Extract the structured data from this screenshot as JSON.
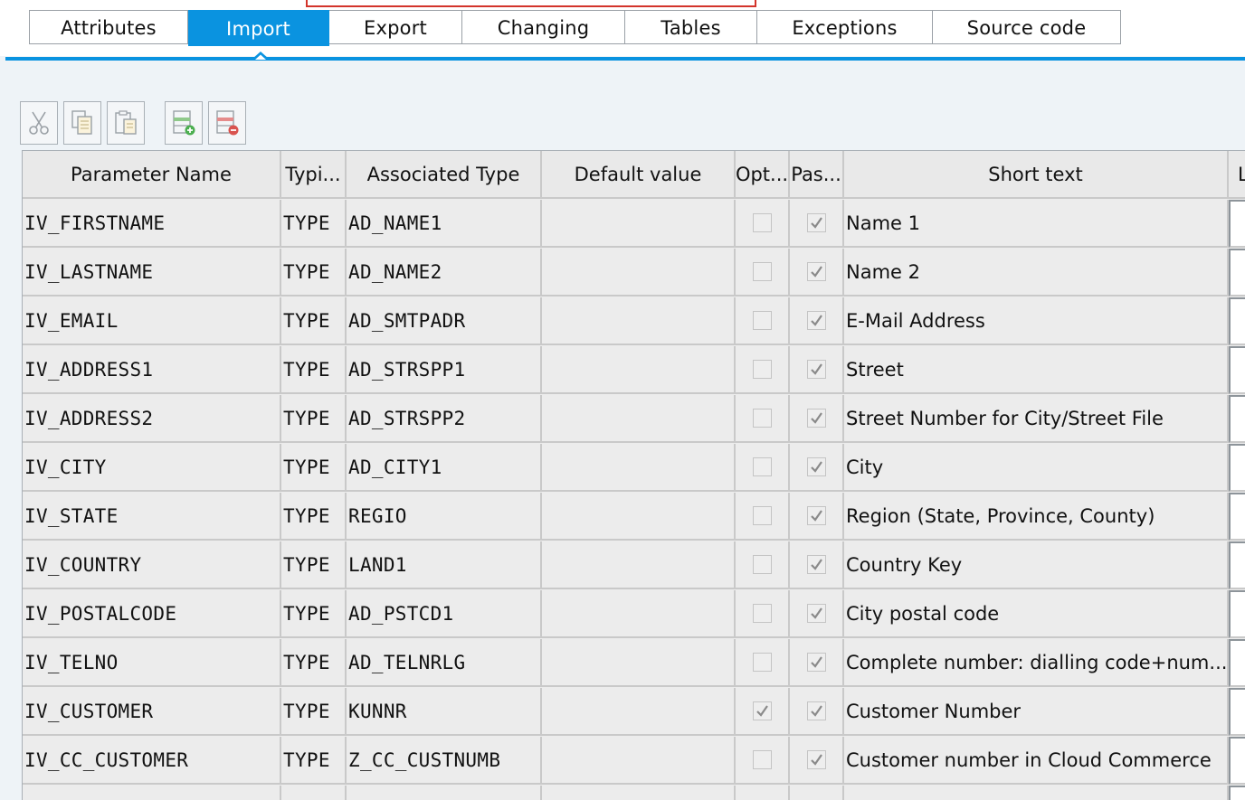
{
  "tabs": [
    {
      "label": "Attributes",
      "active": false
    },
    {
      "label": "Import",
      "active": true
    },
    {
      "label": "Export",
      "active": false
    },
    {
      "label": "Changing",
      "active": false
    },
    {
      "label": "Tables",
      "active": false
    },
    {
      "label": "Exceptions",
      "active": false
    },
    {
      "label": "Source code",
      "active": false
    }
  ],
  "toolbar": {
    "buttons": [
      {
        "icon": "cut-icon"
      },
      {
        "icon": "copy-icon"
      },
      {
        "icon": "paste-icon"
      },
      {
        "icon": "insert-row-icon"
      },
      {
        "icon": "delete-row-icon"
      }
    ]
  },
  "table": {
    "columns": {
      "param": "Parameter Name",
      "typing": "Typi...",
      "assoc": "Associated Type",
      "default": "Default value",
      "optional": "Opt...",
      "pass": "Pas...",
      "short": "Short text",
      "long": "L"
    },
    "rows": [
      {
        "param": "IV_FIRSTNAME",
        "typing": "TYPE",
        "assoc": "AD_NAME1",
        "default": "",
        "optional": false,
        "pass": true,
        "short": "Name 1"
      },
      {
        "param": "IV_LASTNAME",
        "typing": "TYPE",
        "assoc": "AD_NAME2",
        "default": "",
        "optional": false,
        "pass": true,
        "short": "Name 2"
      },
      {
        "param": "IV_EMAIL",
        "typing": "TYPE",
        "assoc": "AD_SMTPADR",
        "default": "",
        "optional": false,
        "pass": true,
        "short": "E-Mail Address"
      },
      {
        "param": "IV_ADDRESS1",
        "typing": "TYPE",
        "assoc": "AD_STRSPP1",
        "default": "",
        "optional": false,
        "pass": true,
        "short": "Street"
      },
      {
        "param": "IV_ADDRESS2",
        "typing": "TYPE",
        "assoc": "AD_STRSPP2",
        "default": "",
        "optional": false,
        "pass": true,
        "short": "Street Number for City/Street File"
      },
      {
        "param": "IV_CITY",
        "typing": "TYPE",
        "assoc": "AD_CITY1",
        "default": "",
        "optional": false,
        "pass": true,
        "short": "City"
      },
      {
        "param": "IV_STATE",
        "typing": "TYPE",
        "assoc": "REGIO",
        "default": "",
        "optional": false,
        "pass": true,
        "short": "Region (State, Province, County)"
      },
      {
        "param": "IV_COUNTRY",
        "typing": "TYPE",
        "assoc": "LAND1",
        "default": "",
        "optional": false,
        "pass": true,
        "short": "Country Key"
      },
      {
        "param": "IV_POSTALCODE",
        "typing": "TYPE",
        "assoc": "AD_PSTCD1",
        "default": "",
        "optional": false,
        "pass": true,
        "short": "City postal code"
      },
      {
        "param": "IV_TELNO",
        "typing": "TYPE",
        "assoc": "AD_TELNRLG",
        "default": "",
        "optional": false,
        "pass": true,
        "short": "Complete number: dialling code+num..."
      },
      {
        "param": "IV_CUSTOMER",
        "typing": "TYPE",
        "assoc": "KUNNR",
        "default": "",
        "optional": true,
        "pass": true,
        "short": "Customer Number"
      },
      {
        "param": "IV_CC_CUSTOMER",
        "typing": "TYPE",
        "assoc": "Z_CC_CUSTNUMB",
        "default": "",
        "optional": false,
        "pass": true,
        "short": "Customer number in Cloud Commerce"
      }
    ]
  },
  "colors": {
    "accent": "#0a93e0",
    "grid_bg": "#ececec",
    "grid_line": "#c9c9c9"
  }
}
